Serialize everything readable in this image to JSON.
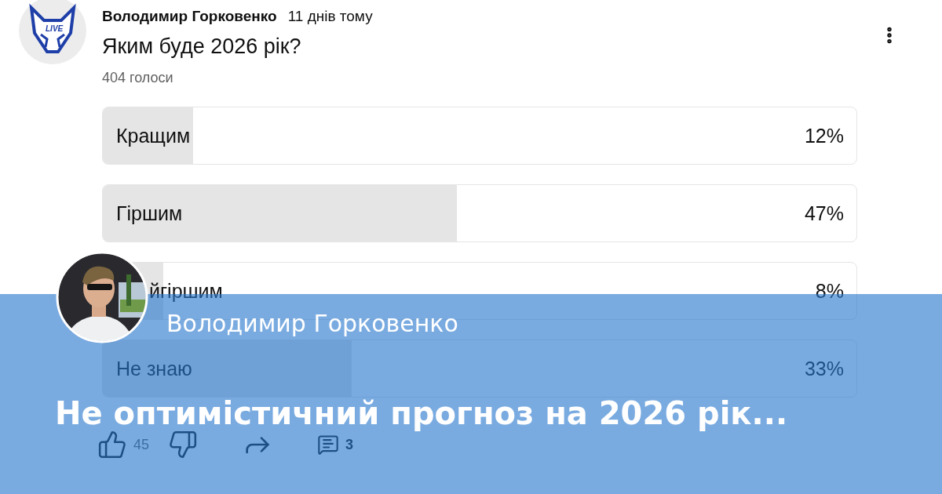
{
  "post": {
    "channel_logo_text": "LIVE",
    "author": "Володимир Горковенко",
    "time": "11 днів тому",
    "question": "Яким буде 2026 рік?",
    "votes": "404 голоси",
    "options": [
      {
        "label": "Кращим",
        "percent": "12%",
        "level": 0.12
      },
      {
        "label": "Гіршим",
        "percent": "47%",
        "level": 0.47
      },
      {
        "label": "йгіршим",
        "percent": "8%",
        "level": 0.08
      },
      {
        "label": "Не знаю",
        "percent": "33%",
        "level": 0.33
      }
    ],
    "likes": "45",
    "comments": "3"
  },
  "banner": {
    "author": "Володимир Горковенко",
    "title": "Не оптимістичний прогноз на 2026 рік..."
  }
}
